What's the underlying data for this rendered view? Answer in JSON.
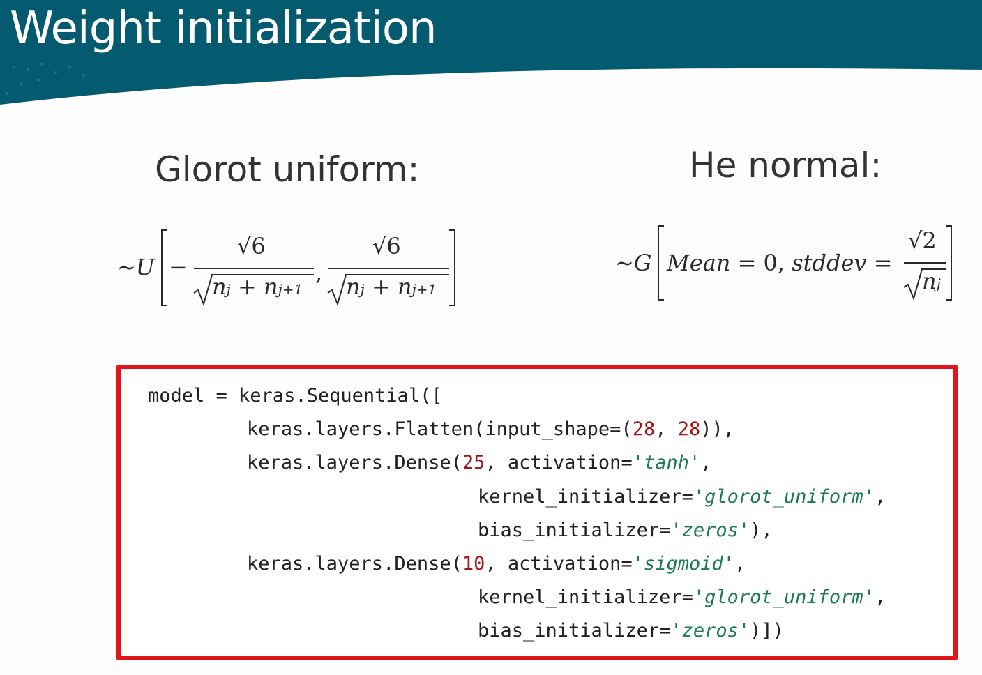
{
  "slide": {
    "title": "Weight initialization",
    "colors": {
      "header": "#045a6e",
      "box_border": "#e0151a",
      "number": "#a3131a",
      "string": "#1d7a52"
    }
  },
  "glorot": {
    "heading": "Glorot uniform:",
    "tilde_u": "~U",
    "minus": "−",
    "numerator": "√6",
    "denominator_a": "n",
    "denominator_sub_a": "j",
    "plus": "+",
    "denominator_b": "n",
    "denominator_sub_b": "j+1",
    "comma": ","
  },
  "he": {
    "heading": "He normal:",
    "tilde_g": "~G",
    "mean_label": "Mean",
    "equals": "=",
    "zero_comma": "0,",
    "stddev_label": "stddev",
    "numerator": "√2",
    "denominator": "n",
    "denominator_sub": "j"
  },
  "code": {
    "lines": [
      {
        "plain": "model = keras.Sequential(["
      },
      {
        "plain": "keras.layers.Flatten(input_shape=(",
        "n1": "28",
        "sep": ", ",
        "n2": "28",
        "tail": ")),"
      },
      {
        "plain": "keras.layers.Dense(",
        "n1": "25",
        "mid": ", activation=",
        "s1": "'tanh'",
        "tail": ","
      },
      {
        "plain": "kernel_initializer=",
        "s1": "'glorot_uniform'",
        "tail": ","
      },
      {
        "plain": "bias_initializer=",
        "s1": "'zeros'",
        "tail": "),"
      },
      {
        "plain": "keras.layers.Dense(",
        "n1": "10",
        "mid": ", activation=",
        "s1": "'sigmoid'",
        "tail": ","
      },
      {
        "plain": "kernel_initializer=",
        "s1": "'glorot_uniform'",
        "tail": ","
      },
      {
        "plain": "bias_initializer=",
        "s1": "'zeros'",
        "tail": ")])"
      }
    ]
  }
}
